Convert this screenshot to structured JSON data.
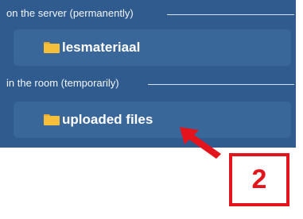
{
  "sections": [
    {
      "label": "on the server (permanently)",
      "folder": {
        "name": "lesmateriaal",
        "icon": "folder-icon"
      }
    },
    {
      "label": "in the room (temporarily)",
      "folder": {
        "name": "uploaded files",
        "icon": "folder-icon"
      }
    }
  ],
  "annotation": {
    "number": "2",
    "color": "#e3141b",
    "arrow_icon": "red-arrow-icon"
  },
  "colors": {
    "panel_background": "#2f5b8f",
    "button_background": "#3a6799",
    "folder": "#f5bf3b"
  }
}
